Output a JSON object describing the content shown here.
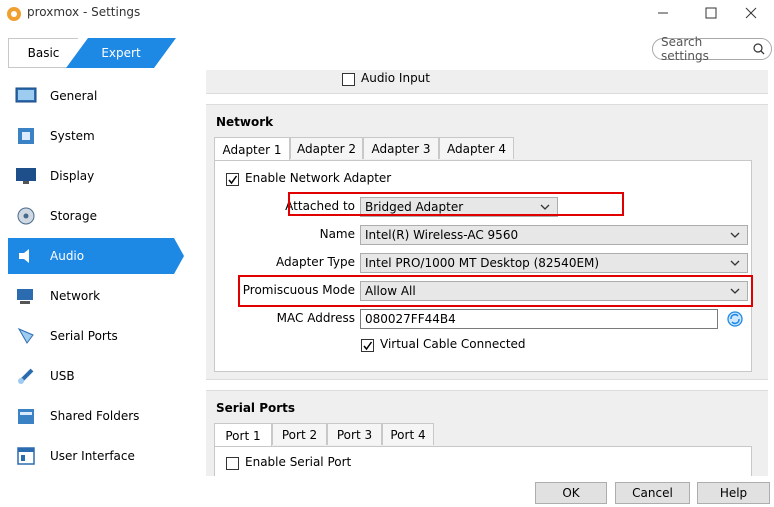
{
  "window": {
    "title": "proxmox - Settings"
  },
  "mode_tabs": {
    "basic": "Basic",
    "expert": "Expert"
  },
  "search": {
    "placeholder": "Search settings"
  },
  "sidebar": {
    "items": [
      {
        "label": "General",
        "icon": "general-icon"
      },
      {
        "label": "System",
        "icon": "system-icon"
      },
      {
        "label": "Display",
        "icon": "display-icon"
      },
      {
        "label": "Storage",
        "icon": "storage-icon"
      },
      {
        "label": "Audio",
        "icon": "audio-icon",
        "active": true
      },
      {
        "label": "Network",
        "icon": "network-icon"
      },
      {
        "label": "Serial Ports",
        "icon": "serial-ports-icon"
      },
      {
        "label": "USB",
        "icon": "usb-icon"
      },
      {
        "label": "Shared Folders",
        "icon": "shared-folders-icon"
      },
      {
        "label": "User Interface",
        "icon": "user-interface-icon"
      }
    ]
  },
  "audio": {
    "audio_input_label": "Audio Input"
  },
  "network": {
    "title": "Network",
    "tabs": [
      "Adapter 1",
      "Adapter 2",
      "Adapter 3",
      "Adapter 4"
    ],
    "enable_label": "Enable Network Adapter",
    "attached_to_label": "Attached to",
    "attached_to_value": "Bridged Adapter",
    "name_label": "Name",
    "name_value": "Intel(R) Wireless-AC 9560",
    "adapter_type_label": "Adapter Type",
    "adapter_type_value": "Intel PRO/1000 MT Desktop (82540EM)",
    "promiscuous_label": "Promiscuous Mode",
    "promiscuous_value": "Allow All",
    "mac_label": "MAC Address",
    "mac_value": "080027FF44B4",
    "cable_label": "Virtual Cable Connected"
  },
  "serial_ports": {
    "title": "Serial Ports",
    "tabs": [
      "Port 1",
      "Port 2",
      "Port 3",
      "Port 4"
    ],
    "enable_label": "Enable Serial Port"
  },
  "footer": {
    "ok": "OK",
    "cancel": "Cancel",
    "help": "Help"
  },
  "colors": {
    "accent": "#1e88e5",
    "highlight": "#e00000"
  }
}
